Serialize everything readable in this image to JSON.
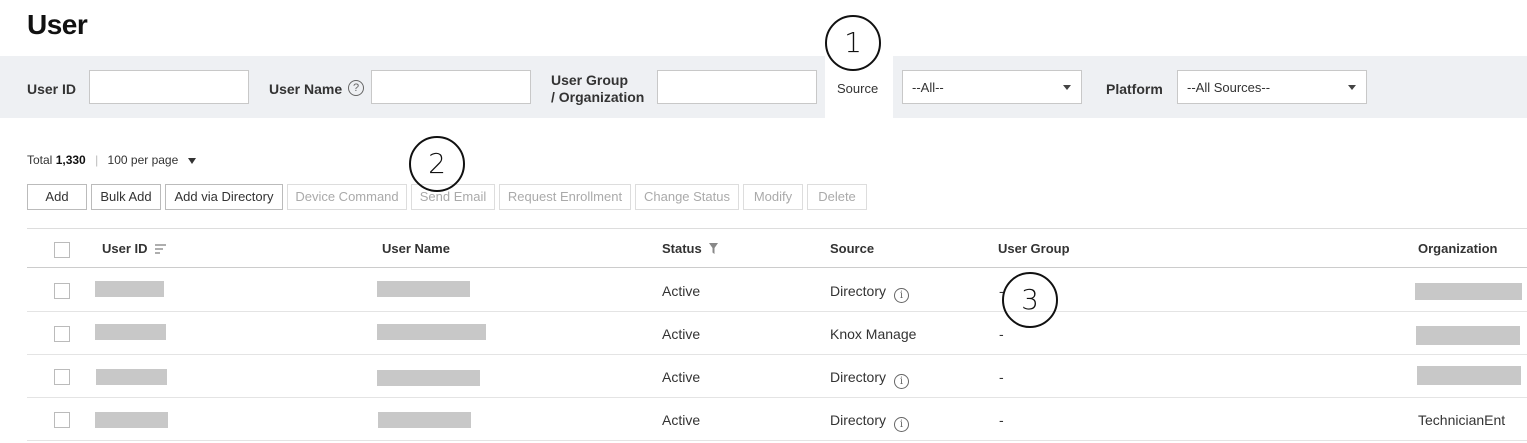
{
  "page": {
    "title": "User"
  },
  "filters": {
    "user_id_label": "User ID",
    "user_name_label": "User Name",
    "user_group_label_line1": "User Group",
    "user_group_label_line2": "/ Organization",
    "source_label": "Source",
    "source_value": "--All--",
    "platform_label": "Platform",
    "platform_value": "--All Sources--"
  },
  "summary": {
    "total_label": "Total",
    "total_count": "1,330",
    "per_page": "100 per page"
  },
  "toolbar": {
    "add": "Add",
    "bulk_add": "Bulk Add",
    "add_via_directory": "Add via Directory",
    "device_command": "Device Command",
    "send_email": "Send Email",
    "request_enrollment": "Request Enrollment",
    "change_status": "Change Status",
    "modify": "Modify",
    "delete": "Delete"
  },
  "table": {
    "columns": {
      "user_id": "User ID",
      "user_name": "User Name",
      "status": "Status",
      "source": "Source",
      "user_group": "User Group",
      "organization": "Organization"
    },
    "rows": [
      {
        "status": "Active",
        "source": "Directory",
        "user_group": "-",
        "organization": ""
      },
      {
        "status": "Active",
        "source": "Knox Manage",
        "user_group": "-",
        "organization": ""
      },
      {
        "status": "Active",
        "source": "Directory",
        "user_group": "-",
        "organization": ""
      },
      {
        "status": "Active",
        "source": "Directory",
        "user_group": "-",
        "organization": "TechnicianEnt"
      }
    ]
  },
  "callouts": {
    "c1": "1",
    "c2": "2",
    "c3": "3"
  },
  "icons": {
    "help": "?",
    "info": "i"
  }
}
